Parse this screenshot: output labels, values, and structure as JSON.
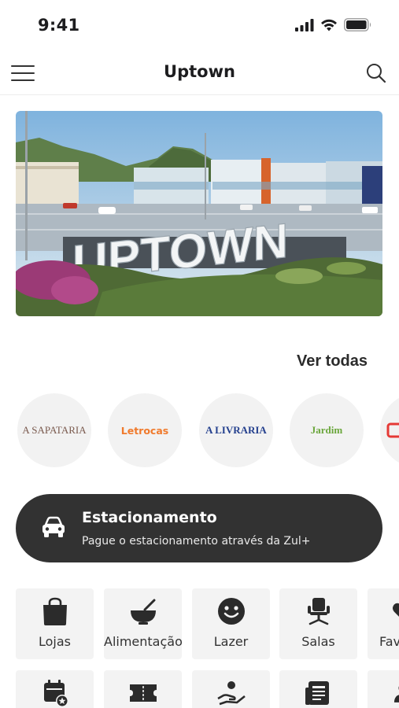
{
  "status_bar": {
    "time": "9:41"
  },
  "nav": {
    "title": "Uptown"
  },
  "hero": {
    "sign_text": "UPTOWN"
  },
  "brands_section": {
    "see_all_label": "Ver todas"
  },
  "brands": [
    {
      "name": "A SAPATARIA",
      "color": "#7a5a4e"
    },
    {
      "name": "Letrocas",
      "color": "#f07a2c"
    },
    {
      "name": "A LIVRARIA",
      "color": "#24408e"
    },
    {
      "name": "Jardim",
      "color": "#6aa63b"
    },
    {
      "name": "",
      "color": "#e53935"
    }
  ],
  "parking": {
    "title": "Estacionamento",
    "subtitle": "Pague o estacionamento através da Zul+"
  },
  "categories": [
    {
      "label": "Lojas",
      "icon": "shopping-bag-icon"
    },
    {
      "label": "Alimentação",
      "icon": "food-bowl-icon"
    },
    {
      "label": "Lazer",
      "icon": "smiley-icon"
    },
    {
      "label": "Salas",
      "icon": "office-chair-icon"
    },
    {
      "label": "Fav",
      "icon": "heart-icon"
    }
  ],
  "categories_row2": [
    {
      "icon": "calendar-star-icon"
    },
    {
      "icon": "ticket-icon"
    },
    {
      "icon": "hand-service-icon"
    },
    {
      "icon": "newspaper-icon"
    },
    {
      "icon": "person-icon"
    }
  ]
}
